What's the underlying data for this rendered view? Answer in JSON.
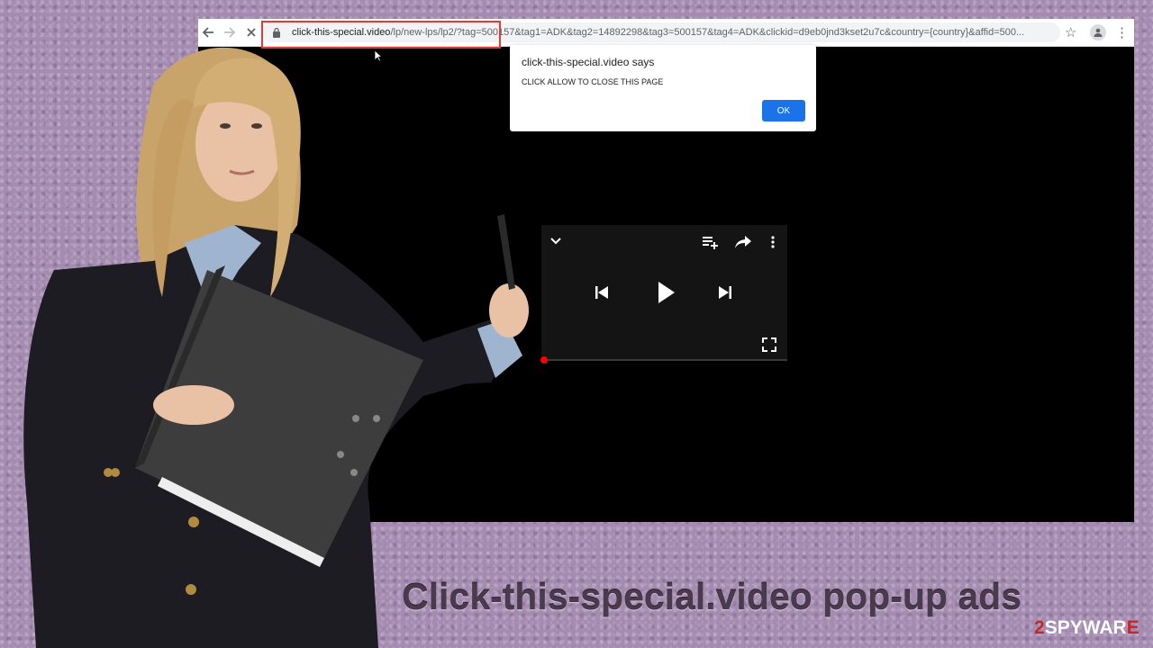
{
  "browser": {
    "url_host": "click-this-special.video",
    "url_path": "/lp/new-lps/lp2/?tag=500157&tag1=ADK&tag2=14892298&tag3=500157&tag4=ADK&clickid=d9eb0jnd3kset2u7c&country={country}&affid=500..."
  },
  "dialog": {
    "title": "click-this-special.video says",
    "message": "CLICK ALLOW TO CLOSE THIS PAGE",
    "ok_label": "OK"
  },
  "player": {
    "progress": 0.0
  },
  "caption": {
    "title": "Click-this-special.video pop-up ads",
    "brand_prefix": "2",
    "brand_main": "SPYWAR",
    "brand_suffix": "E"
  },
  "colors": {
    "background": "#a48bb0",
    "highlight": "#e53935",
    "ok_button": "#1a73e8",
    "progress": "#ff0000",
    "brand_red": "#c62828"
  }
}
